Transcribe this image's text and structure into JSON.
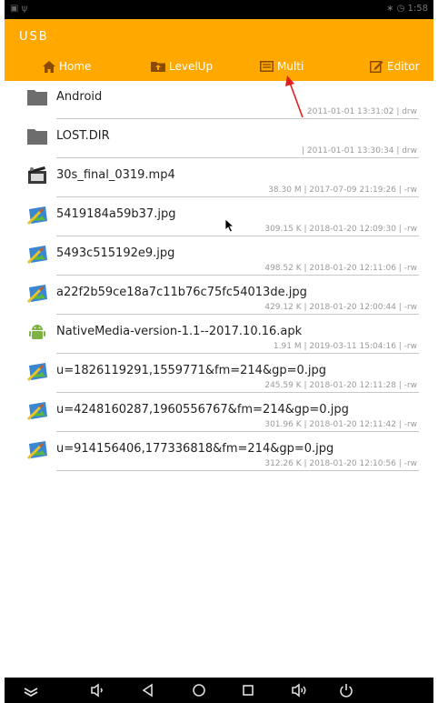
{
  "statusbar": {
    "left": "▣ ψ",
    "right": "∗ ◷ 1:58"
  },
  "header": {
    "title": "USB"
  },
  "toolbar": {
    "home_label": "Home",
    "levelup_label": "LevelUp",
    "multi_label": "Multi",
    "editor_label": "Editor"
  },
  "files": [
    {
      "name": "Android",
      "meta": "2011-01-01 13:31:02 | drw",
      "icon": "folder-icon"
    },
    {
      "name": "LOST.DIR",
      "meta": "| 2011-01-01 13:30:34 | drw",
      "icon": "folder-icon"
    },
    {
      "name": "30s_final_0319.mp4",
      "meta": "38.30 M | 2017-07-09 21:19:26 | -rw",
      "icon": "video-file-icon"
    },
    {
      "name": "5419184a59b37.jpg",
      "meta": "309.15 K | 2018-01-20 12:09:30 | -rw",
      "icon": "image-file-icon"
    },
    {
      "name": "5493c515192e9.jpg",
      "meta": "498.52 K | 2018-01-20 12:11:06 | -rw",
      "icon": "image-file-icon"
    },
    {
      "name": "a22f2b59ce18a7c11b76c75fc54013de.jpg",
      "meta": "429.12 K | 2018-01-20 12:00:44 | -rw",
      "icon": "image-file-icon"
    },
    {
      "name": "NativeMedia-version-1.1--2017.10.16.apk",
      "meta": "1.91 M | 2019-03-11 15:04:16 | -rw",
      "icon": "android-apk-icon"
    },
    {
      "name": "u=1826119291,1559771&fm=214&gp=0.jpg",
      "meta": "245.59 K | 2018-01-20 12:11:28 | -rw",
      "icon": "image-file-icon"
    },
    {
      "name": "u=4248160287,1960556767&fm=214&gp=0.jpg",
      "meta": "301.96 K | 2018-01-20 12:11:42 | -rw",
      "icon": "image-file-icon"
    },
    {
      "name": "u=914156406,177336818&fm=214&gp=0.jpg",
      "meta": "312.26 K | 2018-01-20 12:10:56 | -rw",
      "icon": "image-file-icon"
    }
  ],
  "colors": {
    "header_bg": "#FFA800",
    "annotation_arrow": "#E02020"
  },
  "navbar_icons": [
    "collapse-icon",
    "volume-down-icon",
    "back-icon",
    "home-circle-icon",
    "recents-icon",
    "volume-up-icon",
    "power-icon"
  ]
}
